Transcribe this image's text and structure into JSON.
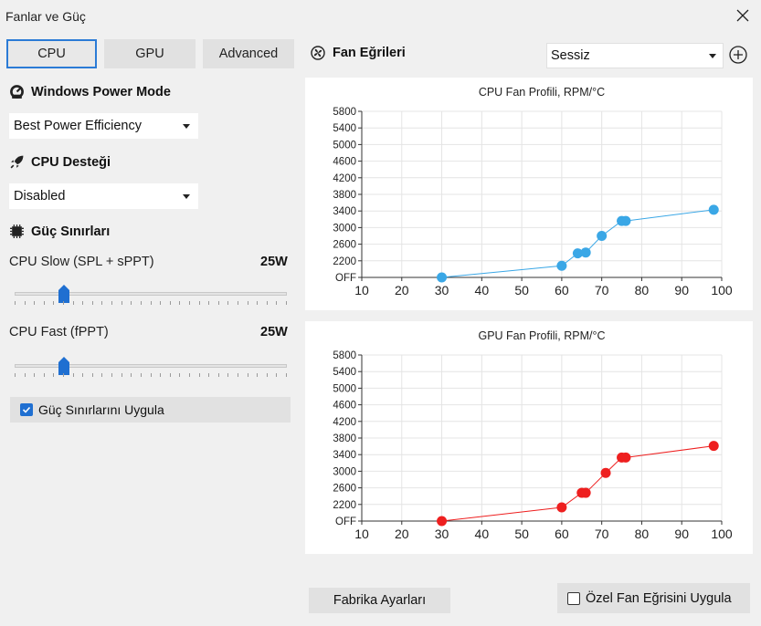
{
  "window": {
    "title": "Fanlar ve Güç"
  },
  "tabs": [
    {
      "label": "CPU",
      "active": true
    },
    {
      "label": "GPU",
      "active": false
    },
    {
      "label": "Advanced",
      "active": false
    }
  ],
  "power_mode": {
    "heading": "Windows Power Mode",
    "icon": "gauge-icon",
    "selected": "Best Power Efficiency"
  },
  "cpu_boost": {
    "heading": "CPU Desteği",
    "icon": "rocket-icon",
    "selected": "Disabled"
  },
  "power_limits": {
    "heading": "Güç Sınırları",
    "icon": "chip-icon",
    "slow": {
      "label": "CPU Slow (SPL + sPPT)",
      "value_label": "25W",
      "fraction": 0.16
    },
    "fast": {
      "label": "CPU Fast (fPPT)",
      "value_label": "25W",
      "fraction": 0.16
    },
    "apply_label": "Güç Sınırlarını Uygula",
    "apply_checked": true
  },
  "fan_curves": {
    "heading": "Fan Eğrileri",
    "icon": "fan-icon",
    "profile": "Sessiz"
  },
  "buttons": {
    "factory_reset": "Fabrika Ayarları",
    "apply_custom_curve": "Özel Fan Eğrisini Uygula",
    "apply_custom_checked": false
  },
  "colors": {
    "accent": "#1f6fd1",
    "cpu_series": "#3aa7e6",
    "gpu_series": "#ee1f1f"
  },
  "chart_data": [
    {
      "type": "line",
      "title": "CPU Fan Profili, RPM/°C",
      "xlim": [
        10,
        100
      ],
      "xticks": [
        10,
        20,
        30,
        40,
        50,
        60,
        70,
        80,
        90,
        100
      ],
      "ylim": [
        1800,
        5800
      ],
      "yticks": [
        "OFF",
        "2200",
        "2600",
        "3000",
        "3400",
        "3800",
        "4200",
        "4600",
        "5000",
        "5400",
        "5800"
      ],
      "ytick_values": [
        1800,
        2200,
        2600,
        3000,
        3400,
        3800,
        4200,
        4600,
        5000,
        5400,
        5800
      ],
      "grid": true,
      "series": [
        {
          "color": "#3aa7e6",
          "x": [
            30,
            60,
            64,
            66,
            70,
            75,
            76,
            98
          ],
          "y": [
            1800,
            2080,
            2380,
            2400,
            2800,
            3160,
            3160,
            3430
          ]
        }
      ]
    },
    {
      "type": "line",
      "title": "GPU Fan Profili, RPM/°C",
      "xlim": [
        10,
        100
      ],
      "xticks": [
        10,
        20,
        30,
        40,
        50,
        60,
        70,
        80,
        90,
        100
      ],
      "ylim": [
        1800,
        5800
      ],
      "yticks": [
        "OFF",
        "2200",
        "2600",
        "3000",
        "3400",
        "3800",
        "4200",
        "4600",
        "5000",
        "5400",
        "5800"
      ],
      "ytick_values": [
        1800,
        2200,
        2600,
        3000,
        3400,
        3800,
        4200,
        4600,
        5000,
        5400,
        5800
      ],
      "grid": true,
      "series": [
        {
          "color": "#ee1f1f",
          "x": [
            30,
            60,
            65,
            66,
            71,
            75,
            76,
            98
          ],
          "y": [
            1800,
            2130,
            2480,
            2480,
            2960,
            3330,
            3330,
            3610
          ]
        }
      ]
    }
  ]
}
